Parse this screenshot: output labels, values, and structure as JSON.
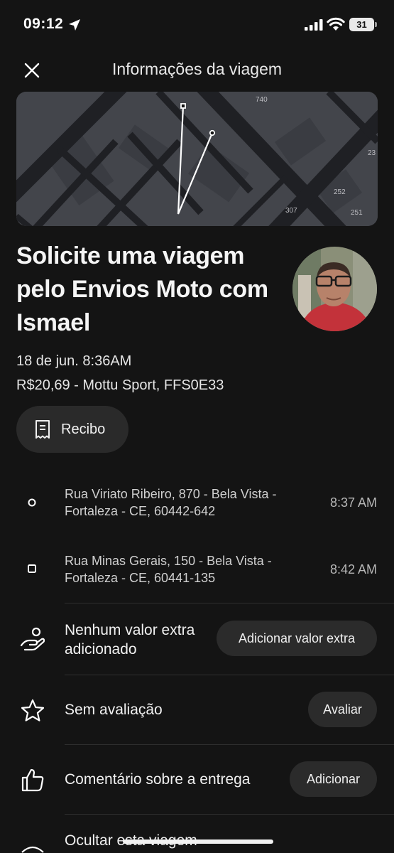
{
  "status_bar": {
    "time": "09:12",
    "battery": "31"
  },
  "header": {
    "title": "Informações da viagem"
  },
  "map": {
    "labels": [
      "740",
      "23",
      "252",
      "307",
      "251"
    ]
  },
  "trip": {
    "title": "Solicite uma viagem pelo Envios Moto com Ismael",
    "date": "18 de jun. 8:36AM",
    "price_vehicle": "R$20,69 - Mottu Sport, FFS0E33",
    "receipt_label": "Recibo"
  },
  "stops": [
    {
      "address": "Rua Viriato Ribeiro, 870 - Bela Vista - Fortaleza - CE, 60442-642",
      "time": "8:37 AM"
    },
    {
      "address": "Rua Minas Gerais, 150 - Bela Vista - Fortaleza - CE, 60441-135",
      "time": "8:42 AM"
    }
  ],
  "actions": {
    "tip": {
      "label": "Nenhum valor extra adicionado",
      "button": "Adicionar valor extra",
      "icon": "hand-coin-icon"
    },
    "rating": {
      "label": "Sem avaliação",
      "button": "Avaliar",
      "icon": "star-icon"
    },
    "feedback": {
      "label": "Comentário sobre a entrega",
      "button": "Adicionar",
      "icon": "thumbs-up-icon"
    },
    "hide": {
      "label": "Ocultar esta viagem",
      "icon": "eye-off-icon"
    }
  },
  "colors": {
    "background": "#141414",
    "surface": "#2a2a2a",
    "map_block": "#43454b",
    "map_road": "#1f2024"
  }
}
